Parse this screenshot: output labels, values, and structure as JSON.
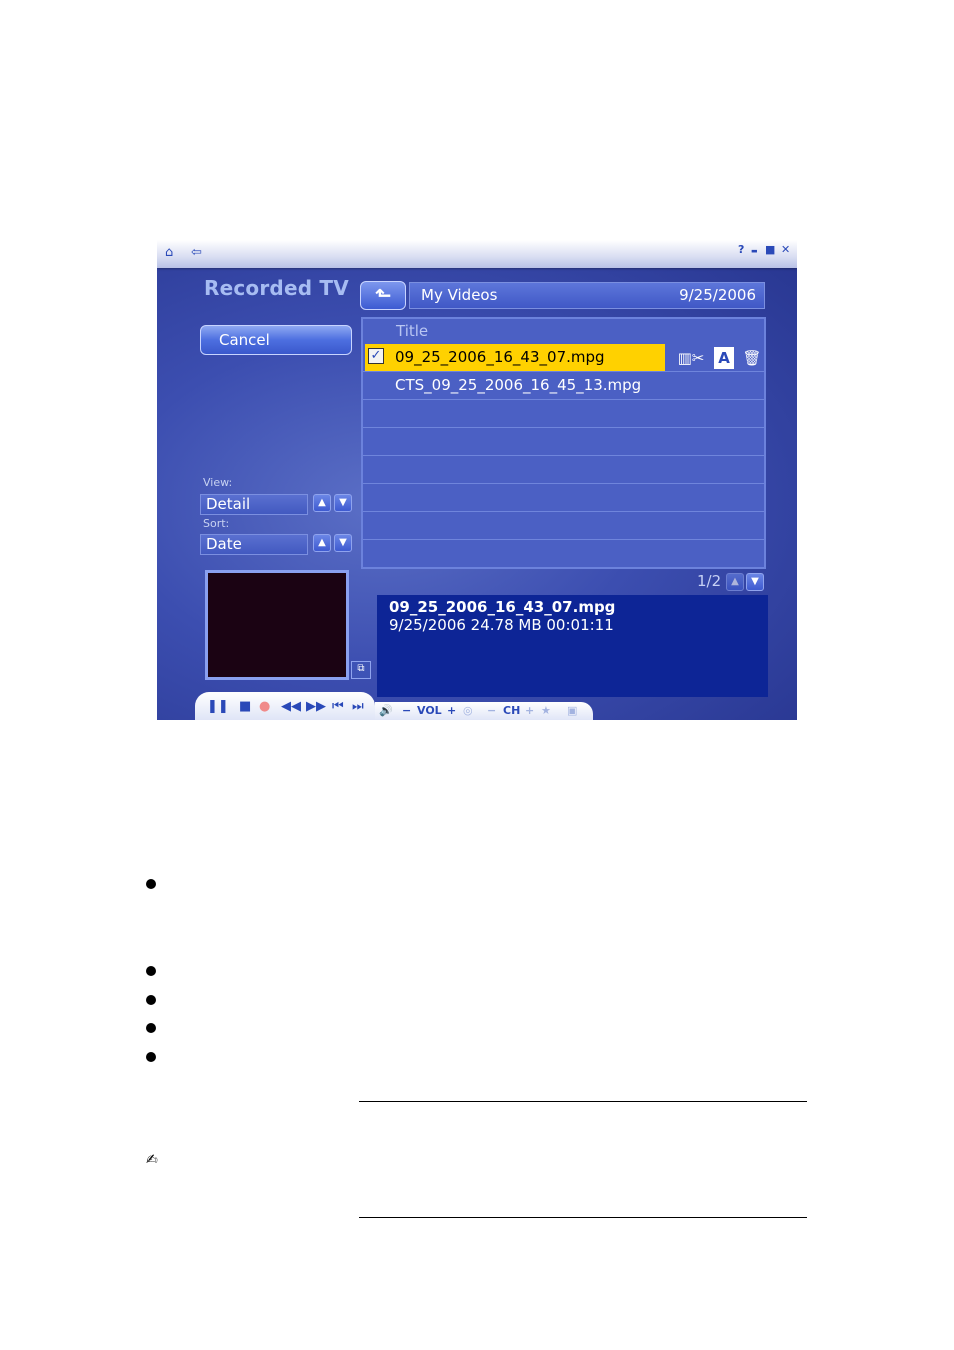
{
  "app": {
    "title": "Recorded TV",
    "titlebar": {
      "home_icon": "house-icon",
      "back_icon": "back-arrow-icon",
      "help": "?",
      "minimize": "▬",
      "maximize": "■",
      "close": "✕"
    },
    "cancel_label": "Cancel",
    "view": {
      "label": "View:",
      "value": "Detail"
    },
    "sort": {
      "label": "Sort:",
      "value": "Date"
    },
    "folder": {
      "name": "My Videos",
      "date": "9/25/2006"
    },
    "list": {
      "header": "Title",
      "items": [
        {
          "name": "09_25_2006_16_43_07.mpg",
          "selected": true
        },
        {
          "name": "CTS_09_25_2006_16_45_13.mpg",
          "selected": false
        }
      ],
      "page": "1/2"
    },
    "info": {
      "filename": "09_25_2006_16_43_07.mpg",
      "details": "9/25/2006  24.78 MB  00:01:11"
    },
    "controls": {
      "vol_label": "VOL",
      "ch_label": "CH"
    }
  },
  "colors": {
    "background": "#3c4eb0",
    "selection": "#ffd100",
    "info_panel": "#0d2596"
  }
}
